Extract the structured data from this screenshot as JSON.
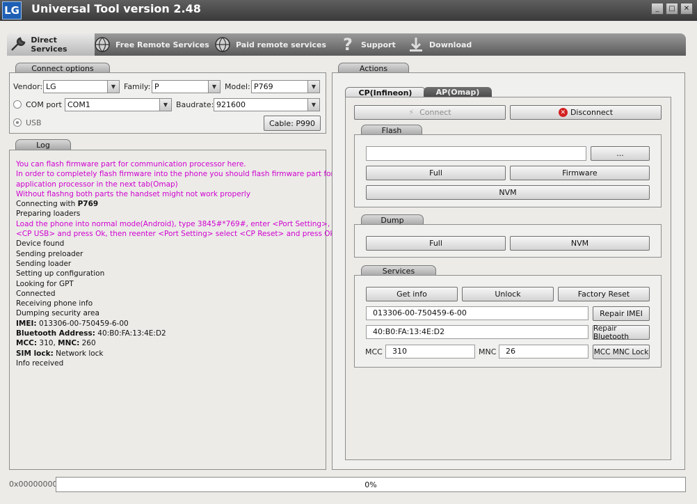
{
  "window": {
    "logo": "LG",
    "title": "Universal Tool version 2.48",
    "controls": {
      "minimize": "_",
      "maximize": "□",
      "close": "✕"
    }
  },
  "nav": {
    "direct": "Direct Services",
    "free": "Free Remote Services",
    "paid": "Paid remote services",
    "support": "Support",
    "download": "Download"
  },
  "connect": {
    "tab": "Connect options",
    "vendor_label": "Vendor:",
    "vendor": "LG",
    "family_label": "Family:",
    "family": "P",
    "model_label": "Model:",
    "model": "P769",
    "com_label": "COM port",
    "com": "COM1",
    "baud_label": "Baudrate:",
    "baud": "921600",
    "usb_label": "USB",
    "cable": "Cable: P990"
  },
  "log": {
    "tab": "Log",
    "lines": [
      {
        "t": "You can flash firmware part for communication processor here.",
        "c": "m"
      },
      {
        "t": "In order to completely flash firmware into the phone you should flash firmware part for",
        "c": "m"
      },
      {
        "t": "application processor in the next tab(Omap)",
        "c": "m"
      },
      {
        "t": "Without flashng both parts the handset might not work properly",
        "c": "m"
      },
      {
        "t": "Connecting with ",
        "b": "P769",
        "c": "k"
      },
      {
        "t": "Preparing loaders",
        "c": "k"
      },
      {
        "t": "Load the phone into normal mode(Android), type 3845#*769#, enter <Port Setting>,  select",
        "c": "m"
      },
      {
        "t": "<CP USB> and press Ok, then reenter <Port Setting> select <CP Reset> and press Ok",
        "c": "m"
      },
      {
        "t": "Device found",
        "c": "k"
      },
      {
        "t": "Sending preloader",
        "c": "k"
      },
      {
        "t": "Sending loader",
        "c": "k"
      },
      {
        "t": "Setting up configuration",
        "c": "k"
      },
      {
        "t": "Looking for GPT",
        "c": "k"
      },
      {
        "t": "Connected",
        "c": "k"
      },
      {
        "t": "Receiving phone info",
        "c": "k"
      },
      {
        "t": "Dumping security area",
        "c": "k"
      },
      {
        "bl": "IMEI:",
        "t": " 013306-00-750459-6-00",
        "c": "k"
      },
      {
        "bl": "Bluetooth Address:",
        "t": " 40:B0:FA:13:4E:D2",
        "c": "k"
      },
      {
        "bl": "MCC:",
        "t": " 310, ",
        "bl2": "MNC:",
        "t2": " 260",
        "c": "k"
      },
      {
        "bl": "SIM lock:",
        "t": " Network lock",
        "c": "k"
      },
      {
        "t": "Info received",
        "c": "k"
      }
    ]
  },
  "actions": {
    "tab": "Actions",
    "subtabs": {
      "cp": "CP(Infineon)",
      "ap": "AP(Omap)"
    },
    "connect": "Connect",
    "disconnect": "Disconnect",
    "flash": {
      "title": "Flash",
      "path": "",
      "browse": "...",
      "full": "Full",
      "firmware": "Firmware",
      "nvm": "NVM"
    },
    "dump": {
      "title": "Dump",
      "full": "Full",
      "nvm": "NVM"
    },
    "services": {
      "title": "Services",
      "getinfo": "Get info",
      "unlock": "Unlock",
      "factory": "Factory Reset",
      "imei": "013306-00-750459-6-00",
      "repair_imei": "Repair IMEI",
      "bt": "40:B0:FA:13:4E:D2",
      "repair_bt": "Repair Bluetooth",
      "mcc_label": "MCC",
      "mcc": "310",
      "mnc_label": "MNC",
      "mnc": "26",
      "mccmnc_lock": "MCC MNC Lock"
    }
  },
  "status": {
    "address": "0x00000000",
    "progress": "0%",
    "progress_value": 0
  }
}
